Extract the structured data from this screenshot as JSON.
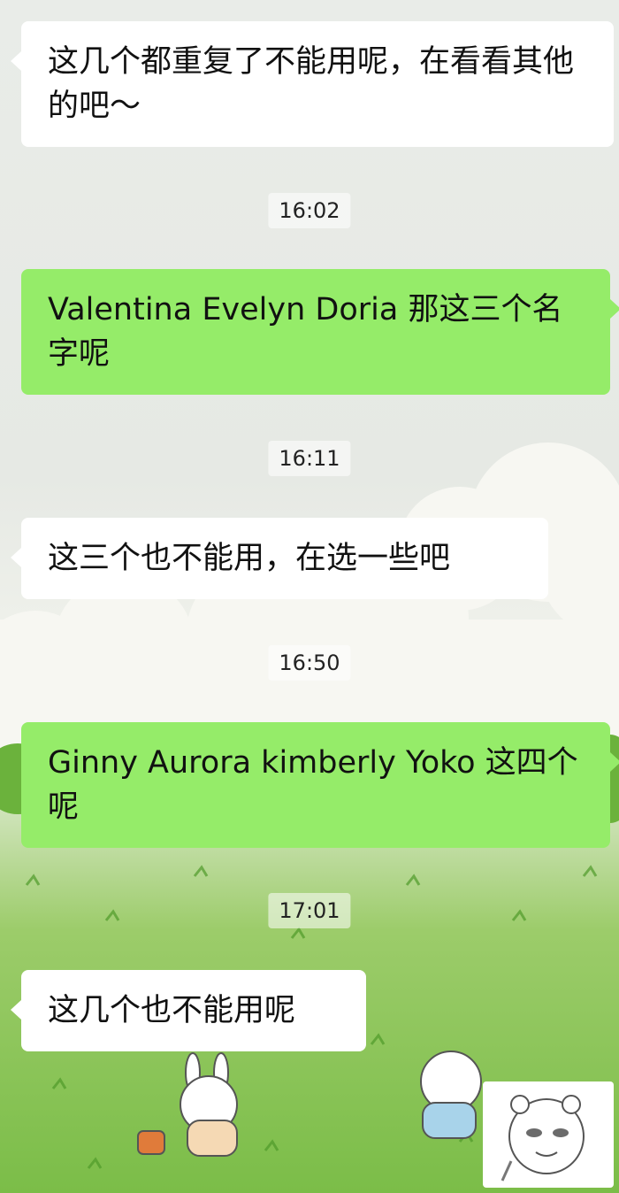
{
  "messages": [
    {
      "type": "received",
      "text": "这几个都重复了不能用呢，在看看其他的吧～"
    },
    {
      "type": "time",
      "text": "16:02"
    },
    {
      "type": "sent",
      "text": "Valentina Evelyn Doria 那这三个名字呢"
    },
    {
      "type": "time",
      "text": "16:11"
    },
    {
      "type": "received",
      "text": "这三个也不能用，在选一些吧"
    },
    {
      "type": "time",
      "text": "16:50"
    },
    {
      "type": "sent",
      "text": "Ginny Aurora kimberly Yoko 这四个呢"
    },
    {
      "type": "time",
      "text": "17:01"
    },
    {
      "type": "received",
      "text": "这几个也不能用呢"
    }
  ],
  "sticker": {
    "icon": "meme-face-sticker-icon"
  },
  "colors": {
    "sent_bubble": "#95ec69",
    "received_bubble": "#ffffff"
  }
}
